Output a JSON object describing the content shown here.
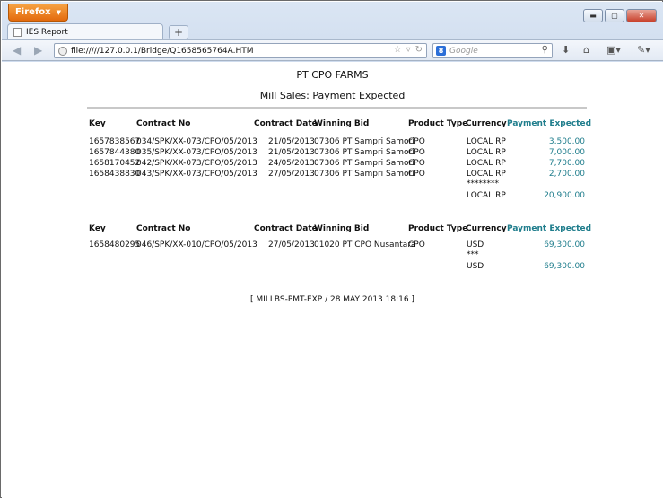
{
  "browser": {
    "app_button": "Firefox",
    "tab_title": "IES Report",
    "new_tab": "+",
    "url": "file://///127.0.0.1/Bridge/Q1658565764A.HTM",
    "search_placeholder": "Google",
    "search_engine_letter": "8"
  },
  "report": {
    "company": "PT CPO FARMS",
    "subtitle": "Mill Sales: Payment Expected",
    "headers": [
      "Key",
      "Contract No",
      "Contract Date",
      "Winning Bid",
      "Product Type",
      "Currency",
      "Payment Expected"
    ],
    "group1": {
      "rows": [
        [
          "1657838567",
          "034/SPK/XX-073/CPO/05/2013",
          "21/05/2013",
          "07306 PT Sampri Samori",
          "CPO",
          "LOCAL RP",
          "3,500.00"
        ],
        [
          "1657844380",
          "035/SPK/XX-073/CPO/05/2013",
          "21/05/2013",
          "07306 PT Sampri Samori",
          "CPO",
          "LOCAL RP",
          "7,000.00"
        ],
        [
          "1658170452",
          "042/SPK/XX-073/CPO/05/2013",
          "24/05/2013",
          "07306 PT Sampri Samori",
          "CPO",
          "LOCAL RP",
          "7,700.00"
        ],
        [
          "1658438830",
          "043/SPK/XX-073/CPO/05/2013",
          "27/05/2013",
          "07306 PT Sampri Samori",
          "CPO",
          "LOCAL RP",
          "2,700.00"
        ]
      ],
      "separator": "********",
      "total_currency": "LOCAL RP",
      "total_amount": "20,900.00"
    },
    "group2": {
      "rows": [
        [
          "1658480295",
          "046/SPK/XX-010/CPO/05/2013",
          "27/05/2013",
          "01020 PT CPO Nusantara",
          "CPO",
          "USD",
          "69,300.00"
        ]
      ],
      "separator": "***",
      "total_currency": "USD",
      "total_amount": "69,300.00"
    },
    "footer": "[ MILLBS-PMT-EXP / 28 MAY 2013 18:16 ]"
  }
}
